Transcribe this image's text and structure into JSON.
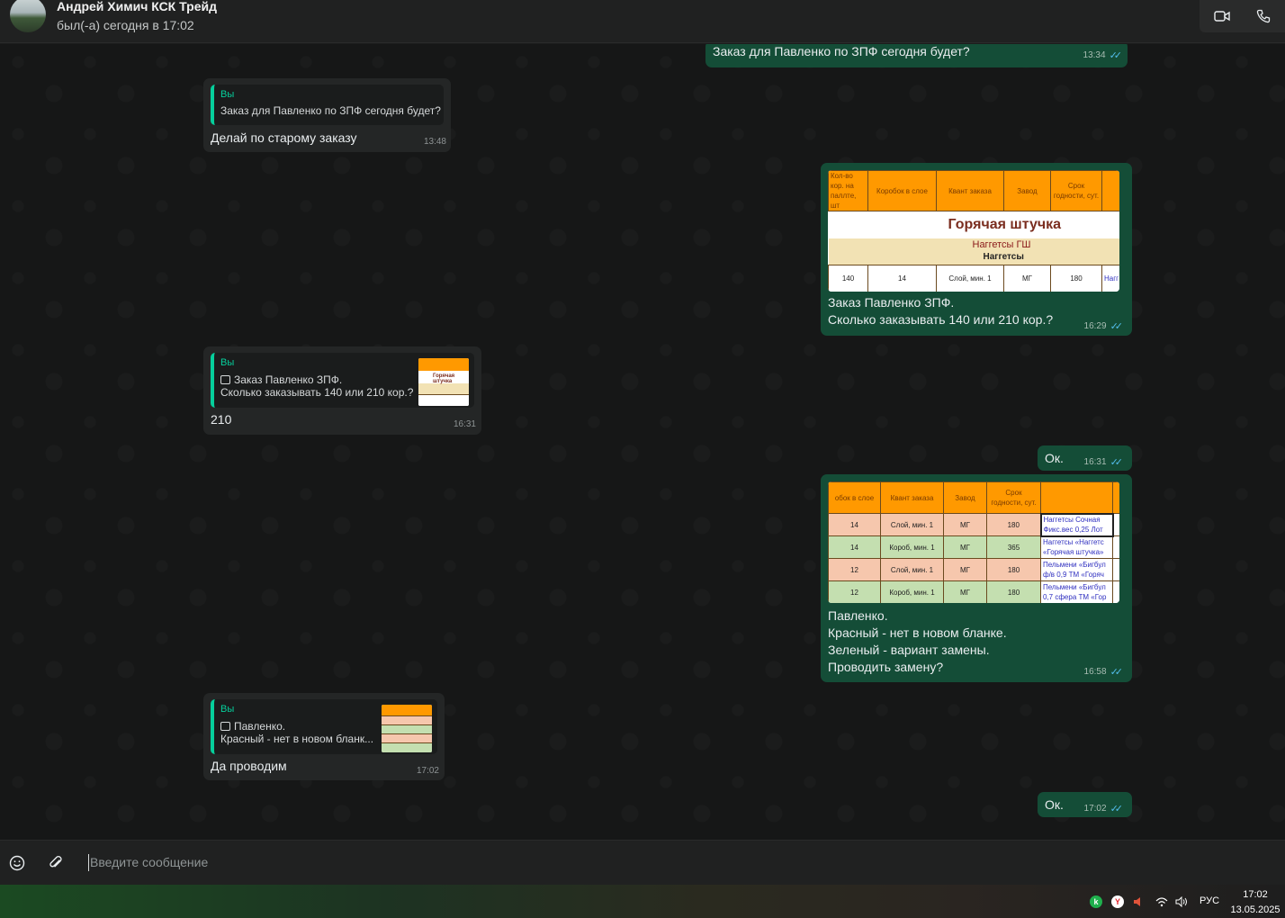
{
  "header": {
    "contact_name": "Андрей Химич КСК Трейд",
    "status": "был(-а) сегодня в 17:02",
    "icons": [
      "video-call-icon",
      "voice-call-icon"
    ]
  },
  "messages": [
    {
      "id": "m1",
      "dir": "out",
      "text": "Заказ для Павленко по ЗПФ сегодня будет?",
      "time": "13:34"
    },
    {
      "id": "m2",
      "dir": "in",
      "quote_author": "Вы",
      "quote_text": "Заказ для Павленко по ЗПФ сегодня будет?",
      "text": "Делай по старому заказу",
      "time": "13:48"
    },
    {
      "id": "m3",
      "dir": "out",
      "text": "Заказ Павленко ЗПФ.\nСколько заказывать 140 или 210 кор.?",
      "time": "16:29"
    },
    {
      "id": "m4",
      "dir": "in",
      "quote_author": "Вы",
      "quote_text": "Заказ Павленко ЗПФ.\nСколько заказывать 140 или 210 кор.?",
      "text": "210",
      "time": "16:31"
    },
    {
      "id": "m5",
      "dir": "out",
      "text": "Ок.",
      "time": "16:31"
    },
    {
      "id": "m6",
      "dir": "out",
      "text": "Павленко.\nКрасный - нет в новом бланке.\nЗеленый - вариант замены.\nПроводить замену?",
      "time": "16:58"
    },
    {
      "id": "m7",
      "dir": "in",
      "quote_author": "Вы",
      "quote_text": "Павленко.\nКрасный - нет в новом бланк...",
      "text": "Да проводим",
      "time": "17:02"
    },
    {
      "id": "m8",
      "dir": "out",
      "text": "Ок.",
      "time": "17:02"
    }
  ],
  "image1": {
    "headers": [
      "Кол-во кор. на паллте, шт",
      "Коробок в слое",
      "Квант заказа",
      "Завод",
      "Срок годности, сут."
    ],
    "brand": "Горячая штучка",
    "product_line1": "Наггетсы ГШ",
    "product_line2": "Наггетсы",
    "row": [
      "140",
      "14",
      "Слой, мин. 1",
      "МГ",
      "180",
      "Нагг и зел"
    ]
  },
  "image2": {
    "headers": [
      "обок в слое",
      "Квант заказа",
      "Завод",
      "Срок годности, сут.",
      ""
    ],
    "rows": [
      {
        "color": "pink",
        "cells": [
          "14",
          "Слой, мин. 1",
          "МГ",
          "180",
          "Наггетсы Сочная Фикс.вес 0,25 Лот"
        ]
      },
      {
        "color": "green",
        "cells": [
          "14",
          "Короб, мин. 1",
          "МГ",
          "365",
          "Наггетсы «Наггетс «Горячая штучка»"
        ]
      },
      {
        "color": "pink",
        "cells": [
          "12",
          "Слой, мин. 1",
          "МГ",
          "180",
          "Пельмени «Бигбул ф/в 0,9 ТМ «Горяч"
        ]
      },
      {
        "color": "green",
        "cells": [
          "12",
          "Короб, мин. 1",
          "МГ",
          "180",
          "Пельмени «Бигбул 0,7 сфера ТМ «Гор"
        ]
      }
    ]
  },
  "composer": {
    "placeholder": "Введите сообщение"
  },
  "taskbar": {
    "lang": "РУС",
    "time": "17:02",
    "date": "13.05.2025"
  },
  "colors": {
    "outgoing": "#144d37",
    "incoming": "#242626",
    "accent": "#06cf9c",
    "read_ticks": "#53bdeb"
  }
}
